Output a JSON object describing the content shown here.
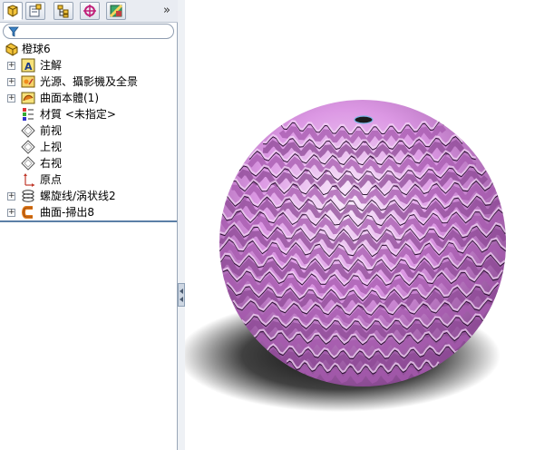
{
  "tabs": [
    {
      "icon": "feature-manager-icon"
    },
    {
      "icon": "property-manager-icon"
    },
    {
      "icon": "configuration-manager-icon"
    },
    {
      "icon": "dimxpert-manager-icon"
    },
    {
      "icon": "display-manager-icon"
    }
  ],
  "tab_more_label": "»",
  "filter": {
    "placeholder": "",
    "icon": "filter-funnel-icon"
  },
  "tree": {
    "root": {
      "label": "橙球6",
      "icon": "part-icon"
    },
    "items": [
      {
        "label": "注解",
        "icon": "annotations-icon",
        "expandable": true
      },
      {
        "label": "光源、攝影機及全景",
        "icon": "lights-cameras-icon",
        "expandable": true
      },
      {
        "label": "曲面本體(1)",
        "icon": "surface-bodies-icon",
        "expandable": true
      },
      {
        "label": "材質 <未指定>",
        "icon": "material-icon",
        "expandable": false
      },
      {
        "label": "前视",
        "icon": "plane-icon",
        "expandable": false
      },
      {
        "label": "上视",
        "icon": "plane-icon",
        "expandable": false
      },
      {
        "label": "右视",
        "icon": "plane-icon",
        "expandable": false
      },
      {
        "label": "原点",
        "icon": "origin-icon",
        "expandable": false
      },
      {
        "label": "螺旋线/涡状线2",
        "icon": "helix-icon",
        "expandable": true
      },
      {
        "label": "曲面-掃出8",
        "icon": "surface-sweep-icon",
        "expandable": true
      }
    ],
    "expander_symbol": "+"
  },
  "viewport": {
    "model": "pink wavy ruffled sphere",
    "model_color": "#d68ee0"
  },
  "colors": {
    "panel_bg": "#ffffff",
    "tab_bg": "#e9ecf2",
    "accent_line": "#5b7fa7"
  }
}
